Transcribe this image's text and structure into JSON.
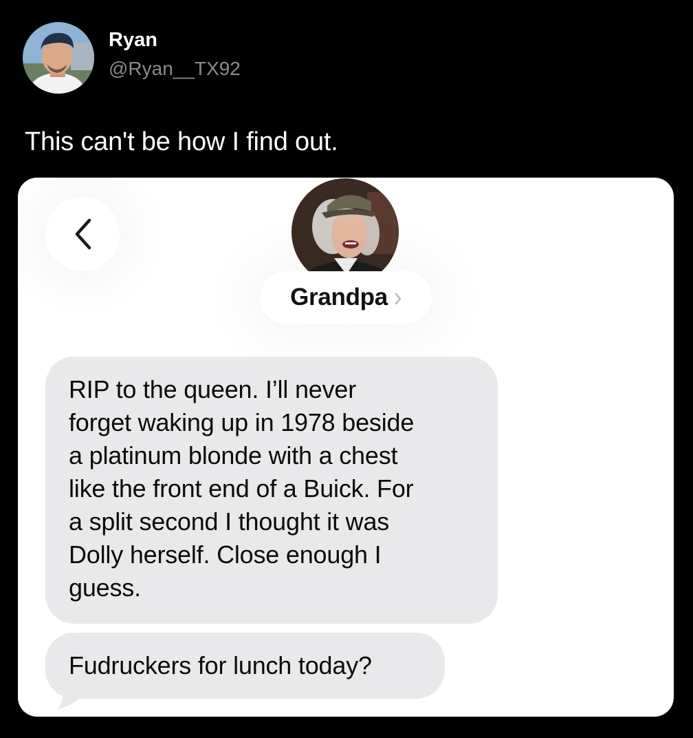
{
  "tweet": {
    "author": {
      "display_name": "Ryan",
      "handle": "@Ryan__TX92",
      "avatar_icon": "profile-photo"
    },
    "text": "This can't be how I find out."
  },
  "screenshot": {
    "back_icon": "chevron-left-icon",
    "contact": {
      "name": "Grandpa",
      "avatar_icon": "profile-photo",
      "chevron_icon": "chevron-right-icon"
    },
    "messages": [
      {
        "lines": [
          "RIP to the queen. I’ll never",
          "forget waking up in 1978 beside",
          "a platinum blonde with a chest",
          "like the front end of a Buick. For",
          "a split second I thought it was",
          "Dolly herself. Close enough I",
          "guess."
        ]
      },
      {
        "lines": [
          "Fudruckers for lunch today?"
        ]
      }
    ],
    "colors": {
      "bubble": "#e9e9eb",
      "card": "#ffffff",
      "background": "#000000",
      "handle": "#8b8b8b"
    }
  }
}
